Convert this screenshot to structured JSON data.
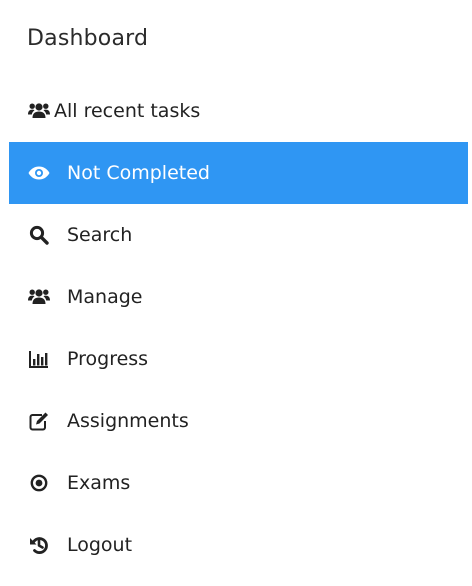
{
  "sidebar": {
    "title": "Dashboard",
    "accent_color": "#2f96f3",
    "items": [
      {
        "label": "All recent tasks",
        "icon": "users-icon",
        "active": false
      },
      {
        "label": "Not Completed",
        "icon": "eye-icon",
        "active": true
      },
      {
        "label": "Search",
        "icon": "search-icon",
        "active": false
      },
      {
        "label": "Manage",
        "icon": "users-icon",
        "active": false
      },
      {
        "label": "Progress",
        "icon": "bar-chart-icon",
        "active": false
      },
      {
        "label": "Assignments",
        "icon": "edit-icon",
        "active": false
      },
      {
        "label": "Exams",
        "icon": "dot-circle-icon",
        "active": false
      },
      {
        "label": "Logout",
        "icon": "logout-icon",
        "active": false
      }
    ]
  }
}
